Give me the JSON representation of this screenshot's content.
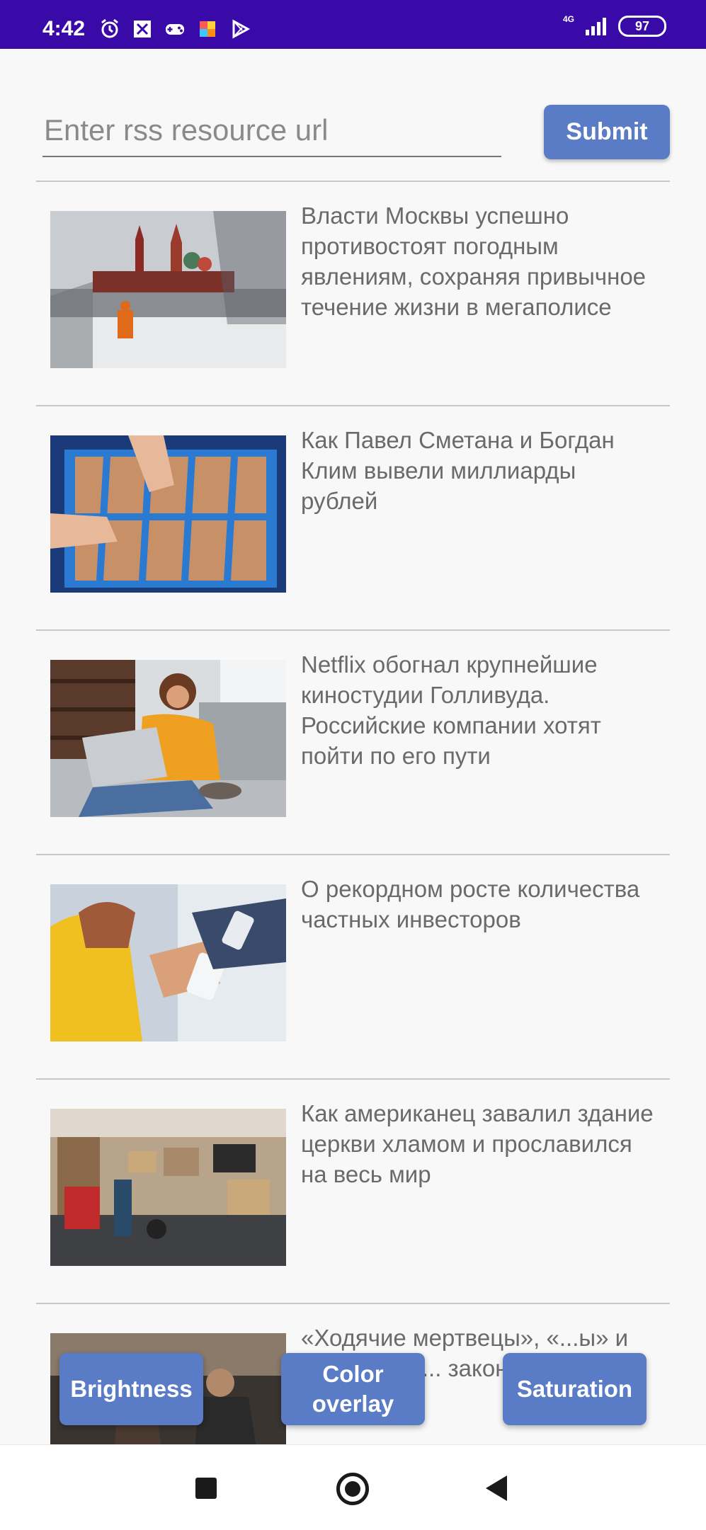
{
  "status_bar": {
    "time": "4:42",
    "network": "4G",
    "battery": "97"
  },
  "form": {
    "url_placeholder": "Enter rss resource url",
    "submit_label": "Submit"
  },
  "news": [
    {
      "title": "Власти Москвы успешно противостоят погодным явлениям, сохраняя привычное течение жизни в мегаполисе"
    },
    {
      "title": "Как Павел Сметана и Богдан Клим вывели миллиарды рублей"
    },
    {
      "title": "Netflix обогнал крупнейшие киностудии Голливуда. Российские компании хотят пойти по его пути"
    },
    {
      "title": "О рекордном росте количества частных инвесторов"
    },
    {
      "title": "Как американец завалил здание церкви хламом и прославился на весь мир"
    },
    {
      "title": "«Ходячие мертвецы», «...ы» и не...иалы п... закончить задолго до"
    }
  ],
  "overlay_buttons": {
    "brightness": "Brightness",
    "color_overlay": "Color overlay",
    "saturation": "Saturation"
  },
  "colors": {
    "status_bar": "#3a0aa8",
    "accent_button": "#5a7cc6"
  }
}
